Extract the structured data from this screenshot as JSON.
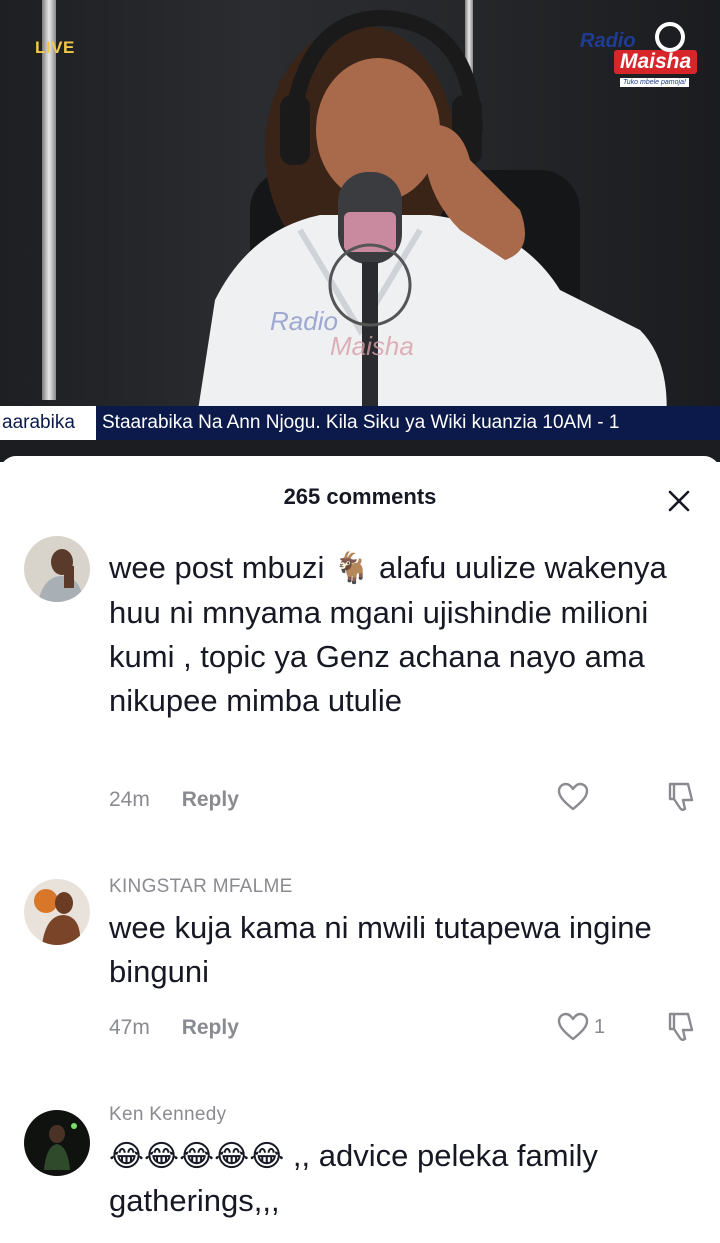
{
  "video": {
    "live_label": "LIVE",
    "logo": {
      "line1": "Radio",
      "line2": "Maisha",
      "tagline": "Tuko mbele pamoja!"
    },
    "ticker": {
      "tab": "aarabika",
      "text": "Staarabika Na Ann Njogu. Kila Siku ya Wiki kuanzia 10AM - 1"
    }
  },
  "comments_panel": {
    "title": "265 comments",
    "items": [
      {
        "author": "",
        "text_part1": "wee post mbuzi",
        "emoji": "🐐",
        "text_part2": " alafu uulize wakenya huu ni mnyama mgani ujishindie milioni kumi , topic ya Genz achana nayo ama nikupee mimba utulie",
        "time": "24m",
        "reply": "Reply",
        "likes": ""
      },
      {
        "author": "KINGSTAR MFALME",
        "text": "wee kuja kama ni mwili tutapewa ingine binguni",
        "time": "47m",
        "reply": "Reply",
        "likes": "1"
      },
      {
        "author": "Ken Kennedy",
        "emoji": "😂😂😂😂😂",
        "text": ",, advice peleka family gatherings,,,"
      }
    ]
  },
  "icons": {
    "close": "close-icon",
    "like": "heart-icon",
    "dislike": "thumbs-down-icon"
  },
  "colors": {
    "ticker_bg": "#0c1a4b",
    "live": "#f2c84b",
    "brand_red": "#d7262a",
    "brand_blue": "#1f3c93",
    "muted_text": "#8a8b91",
    "primary_text": "#161823"
  }
}
